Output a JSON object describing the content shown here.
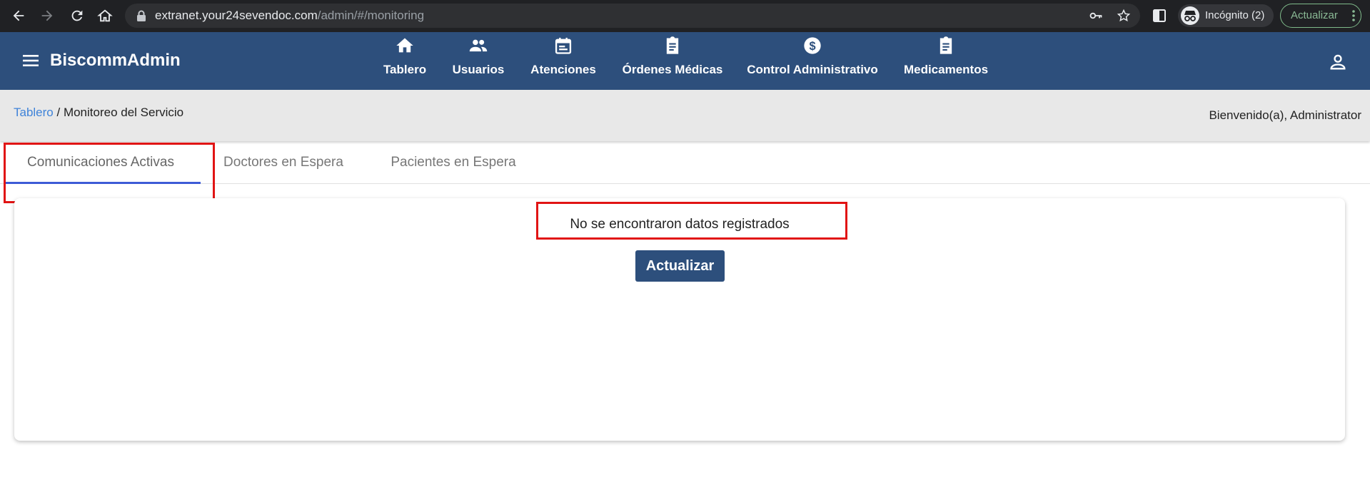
{
  "browser": {
    "url_host": "extranet.your24sevendoc.com",
    "url_path": "/admin/#/monitoring",
    "incognito_label": "Incógnito (2)",
    "update_label": "Actualizar"
  },
  "app": {
    "brand": "BiscommAdmin",
    "nav": [
      {
        "label": "Tablero",
        "icon": "home-icon"
      },
      {
        "label": "Usuarios",
        "icon": "people-icon"
      },
      {
        "label": "Atenciones",
        "icon": "calendar-icon"
      },
      {
        "label": "Órdenes Médicas",
        "icon": "clipboard-icon"
      },
      {
        "label": "Control Administrativo",
        "icon": "dollar-icon"
      },
      {
        "label": "Medicamentos",
        "icon": "clipboard-icon"
      }
    ]
  },
  "breadcrumb": {
    "link": "Tablero",
    "separator": " / ",
    "current": "Monitoreo del Servicio"
  },
  "welcome": "Bienvenido(a), Administrator",
  "tabs": [
    {
      "label": "Comunicaciones Activas",
      "active": true
    },
    {
      "label": "Doctores en Espera",
      "active": false
    },
    {
      "label": "Pacientes en Espera",
      "active": false
    }
  ],
  "content": {
    "empty_message": "No se encontraron datos registrados",
    "refresh_label": "Actualizar"
  },
  "colors": {
    "header": "#2d4f7c",
    "highlight": "#e11414",
    "tab_underline": "#3d5bd6"
  }
}
